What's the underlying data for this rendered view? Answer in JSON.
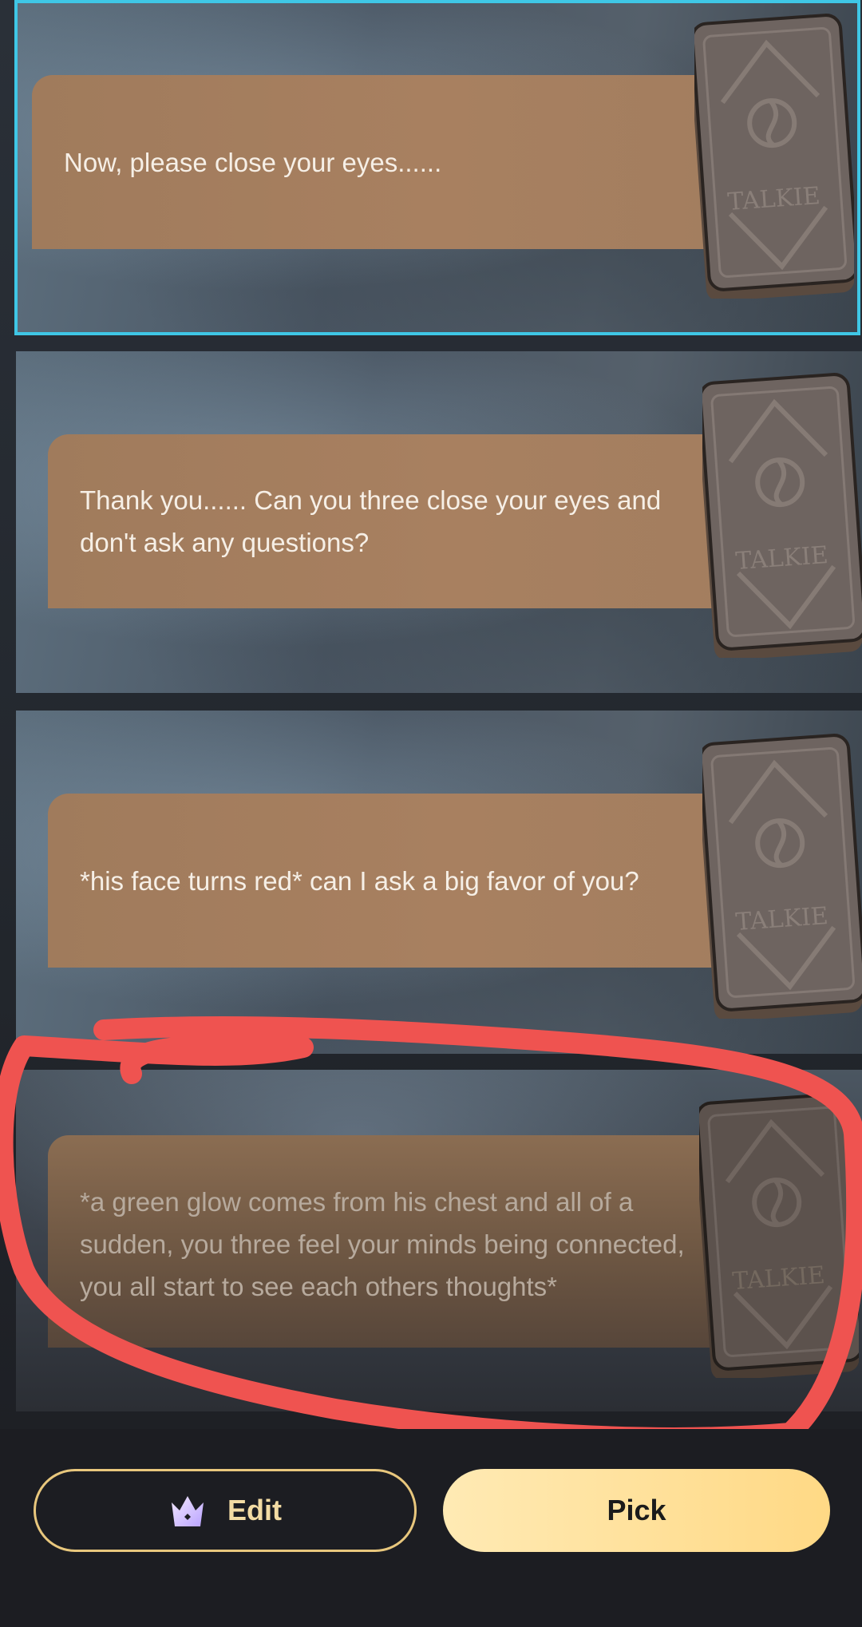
{
  "options": [
    {
      "text": "Now, please close your eyes......",
      "selected": true
    },
    {
      "text": "Thank you...... Can you three close your eyes and don't ask any questions?",
      "selected": false
    },
    {
      "text": "*his face turns red* can I ask a big favor of you?",
      "selected": false
    },
    {
      "text": "*a green glow comes from his chest and all of a sudden, you three feel your minds being connected, you all start to see each others thoughts*",
      "selected": false
    }
  ],
  "card": {
    "brand": "TALKIE",
    "icon": "tarot-card-back-icon"
  },
  "annotation": {
    "color": "#ef5350",
    "shape": "hand-drawn-loop"
  },
  "buttons": {
    "edit": {
      "label": "Edit",
      "icon": "crown-icon"
    },
    "pick": {
      "label": "Pick"
    }
  },
  "colors": {
    "selection_border": "#3fc7e6",
    "bubble": "#a37e5f",
    "edit_border": "#e8c77d",
    "pick_fill": "#ffd985"
  }
}
